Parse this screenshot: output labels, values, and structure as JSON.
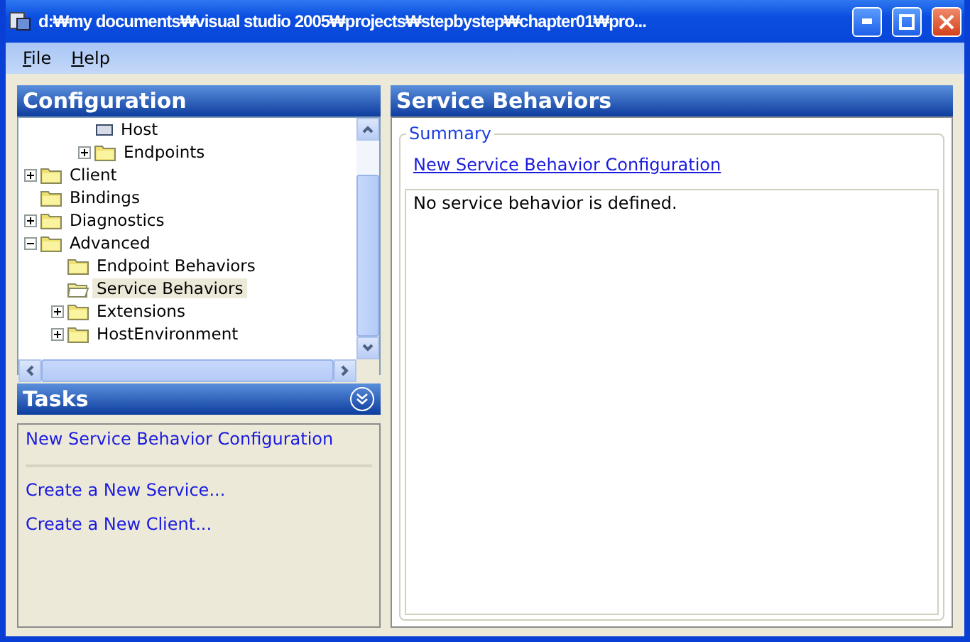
{
  "window": {
    "title": "d:₩my documents₩visual studio 2005₩projects₩stepbystep₩chapter01₩pro..."
  },
  "menu": [
    {
      "label": "File"
    },
    {
      "label": "Help"
    }
  ],
  "configuration": {
    "title": "Configuration",
    "tree": [
      {
        "children": [
          {
            "children": [
              {
                "label": "Host",
                "kind": "host",
                "selected": false
              },
              {
                "label": "Endpoints",
                "kind": "folder",
                "expanded": false,
                "selected": false
              }
            ]
          }
        ]
      },
      {
        "label": "Client",
        "kind": "folder",
        "expanded": false,
        "selected": false
      },
      {
        "label": "Bindings",
        "kind": "folder",
        "selected": false
      },
      {
        "label": "Diagnostics",
        "kind": "folder",
        "expanded": false,
        "selected": false
      },
      {
        "label": "Advanced",
        "kind": "folder",
        "expanded": true,
        "selected": false,
        "children": [
          {
            "label": "Endpoint Behaviors",
            "kind": "folder",
            "selected": false
          },
          {
            "label": "Service Behaviors",
            "kind": "folder-open",
            "selected": true
          },
          {
            "label": "Extensions",
            "kind": "folder",
            "expanded": false,
            "selected": false
          },
          {
            "label": "HostEnvironment",
            "kind": "folder",
            "expanded": false,
            "selected": false
          }
        ]
      }
    ]
  },
  "tasks": {
    "title": "Tasks",
    "primary": "New Service Behavior Configuration",
    "links": [
      "Create a New Service...",
      "Create a New Client..."
    ]
  },
  "detail": {
    "title": "Service Behaviors",
    "group": "Summary",
    "link": "New Service Behavior Configuration",
    "message": "No service behavior is defined."
  }
}
